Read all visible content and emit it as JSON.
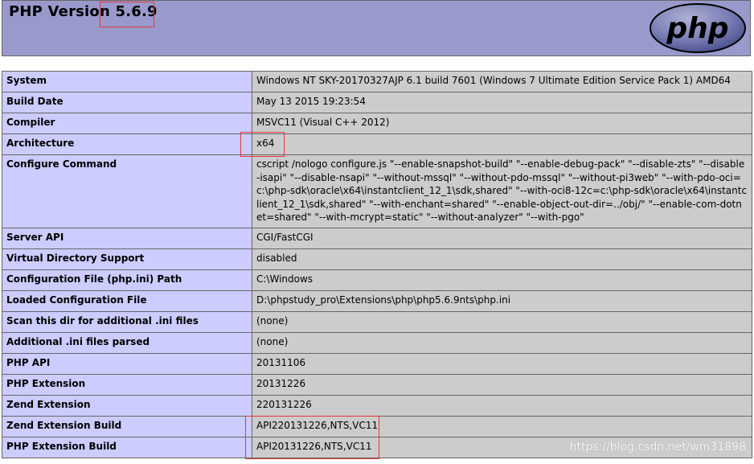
{
  "header": {
    "title_prefix": "PHP Version",
    "version": "5.6.9",
    "logo_icon": "php-logo",
    "logo_text": "php"
  },
  "rows": [
    {
      "key": "System",
      "value": "Windows NT SKY-20170327AJP 6.1 build 7601 (Windows 7 Ultimate Edition Service Pack 1) AMD64"
    },
    {
      "key": "Build Date",
      "value": "May 13 2015 19:23:54"
    },
    {
      "key": "Compiler",
      "value": "MSVC11 (Visual C++ 2012)"
    },
    {
      "key": "Architecture",
      "value": "x64"
    },
    {
      "key": "Configure Command",
      "value": "cscript /nologo configure.js \"--enable-snapshot-build\" \"--enable-debug-pack\" \"--disable-zts\" \"--disable-isapi\" \"--disable-nsapi\" \"--without-mssql\" \"--without-pdo-mssql\" \"--without-pi3web\" \"--with-pdo-oci=c:\\php-sdk\\oracle\\x64\\instantclient_12_1\\sdk,shared\" \"--with-oci8-12c=c:\\php-sdk\\oracle\\x64\\instantclient_12_1\\sdk,shared\" \"--with-enchant=shared\" \"--enable-object-out-dir=../obj/\" \"--enable-com-dotnet=shared\" \"--with-mcrypt=static\" \"--without-analyzer\" \"--with-pgo\""
    },
    {
      "key": "Server API",
      "value": "CGI/FastCGI"
    },
    {
      "key": "Virtual Directory Support",
      "value": "disabled"
    },
    {
      "key": "Configuration File (php.ini) Path",
      "value": "C:\\Windows"
    },
    {
      "key": "Loaded Configuration File",
      "value": "D:\\phpstudy_pro\\Extensions\\php\\php5.6.9nts\\php.ini"
    },
    {
      "key": "Scan this dir for additional .ini files",
      "value": "(none)"
    },
    {
      "key": "Additional .ini files parsed",
      "value": "(none)"
    },
    {
      "key": "PHP API",
      "value": "20131106"
    },
    {
      "key": "PHP Extension",
      "value": "20131226"
    },
    {
      "key": "Zend Extension",
      "value": "220131226"
    },
    {
      "key": "Zend Extension Build",
      "value": "API220131226,NTS,VC11"
    },
    {
      "key": "PHP Extension Build",
      "value": "API20131226,NTS,VC11"
    }
  ],
  "watermark": "https://blog.csdn.net/wm31898",
  "colors": {
    "header_bg": "#9999cc",
    "key_bg": "#ccccff",
    "value_bg": "#cccccc",
    "highlight": "#e53935"
  }
}
